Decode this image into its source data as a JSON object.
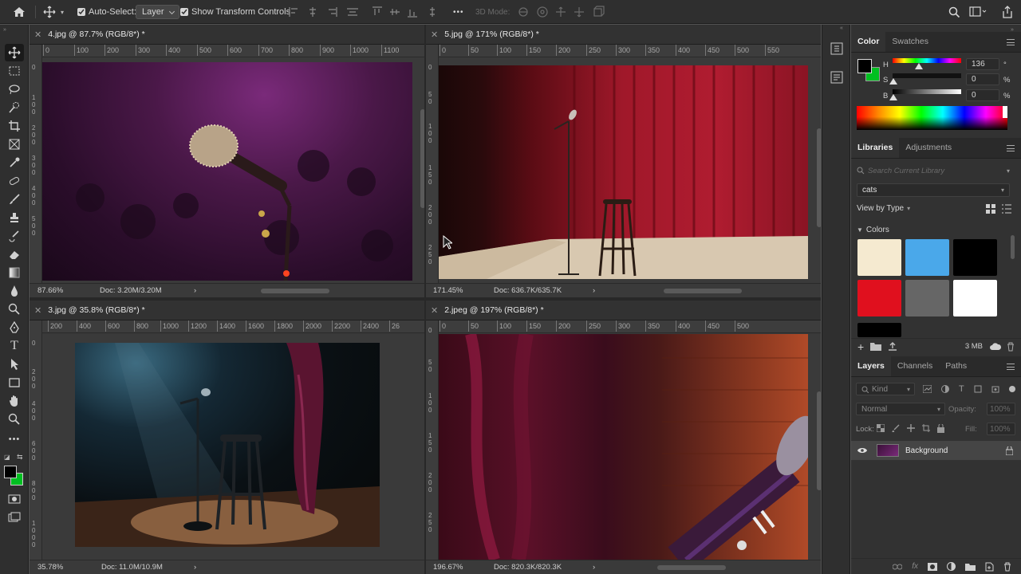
{
  "options_bar": {
    "auto_select_label": "Auto-Select:",
    "auto_select_value": "Layer",
    "transform_label": "Show Transform Controls",
    "more_label": "•••",
    "mode_3d_label": "3D Mode:"
  },
  "documents": [
    {
      "title": "4.jpg @ 87.7% (RGB/8*) *",
      "zoom": "87.66%",
      "doc": "Doc: 3.20M/3.20M",
      "ruler": [
        "0",
        "100",
        "200",
        "300",
        "400",
        "500",
        "600",
        "700",
        "800",
        "900",
        "1000",
        "1100"
      ],
      "vruler": [
        "0",
        "1 0 0",
        "2 0 0",
        "3 0 0",
        "4 0 0",
        "5 0 0"
      ]
    },
    {
      "title": "5.jpg @ 171% (RGB/8*) *",
      "zoom": "171.45%",
      "doc": "Doc: 636.7K/635.7K",
      "ruler": [
        "0",
        "50",
        "100",
        "150",
        "200",
        "250",
        "300",
        "350",
        "400",
        "450",
        "500",
        "550"
      ],
      "vruler": [
        "0",
        "5 0",
        "1 0 0",
        "1 5 0",
        "2 0 0",
        "2 5 0"
      ]
    },
    {
      "title": "3.jpg @ 35.8% (RGB/8*) *",
      "zoom": "35.78%",
      "doc": "Doc: 11.0M/10.9M",
      "ruler": [
        "200",
        "400",
        "600",
        "800",
        "1000",
        "1200",
        "1400",
        "1600",
        "1800",
        "2000",
        "2200",
        "2400",
        "26"
      ],
      "vruler": [
        "0",
        "2 0 0",
        "4 0 0",
        "6 0 0",
        "8 0 0",
        "1 0 0 0"
      ]
    },
    {
      "title": "2.jpeg @ 197% (RGB/8*) *",
      "zoom": "196.67%",
      "doc": "Doc: 820.3K/820.3K",
      "ruler": [
        "0",
        "50",
        "100",
        "150",
        "200",
        "250",
        "300",
        "350",
        "400",
        "450",
        "500"
      ],
      "vruler": [
        "0",
        "5 0",
        "1 0 0",
        "1 5 0",
        "2 0 0",
        "2 5 0"
      ]
    }
  ],
  "color_panel": {
    "tabs": [
      "Color",
      "Swatches"
    ],
    "h_label": "H",
    "h_value": "136",
    "h_unit": "°",
    "s_label": "S",
    "s_value": "0",
    "s_unit": "%",
    "b_label": "B",
    "b_value": "0",
    "b_unit": "%",
    "foreground": "#000000",
    "background": "#00c021"
  },
  "libraries_panel": {
    "tabs": [
      "Libraries",
      "Adjustments"
    ],
    "search_placeholder": "Search Current Library",
    "library": "cats",
    "view_by": "View by Type",
    "section": "Colors",
    "swatches": [
      "#f5ead0",
      "#4aa8ea",
      "#000000",
      "#e0101e",
      "#666666",
      "#ffffff",
      "#000000"
    ],
    "size": "3 MB"
  },
  "layers_panel": {
    "tabs": [
      "Layers",
      "Channels",
      "Paths"
    ],
    "kind_label": "Kind",
    "blend_mode": "Normal",
    "opacity_label": "Opacity:",
    "opacity_value": "100%",
    "lock_label": "Lock:",
    "fill_label": "Fill:",
    "fill_value": "100%",
    "layer_name": "Background"
  }
}
